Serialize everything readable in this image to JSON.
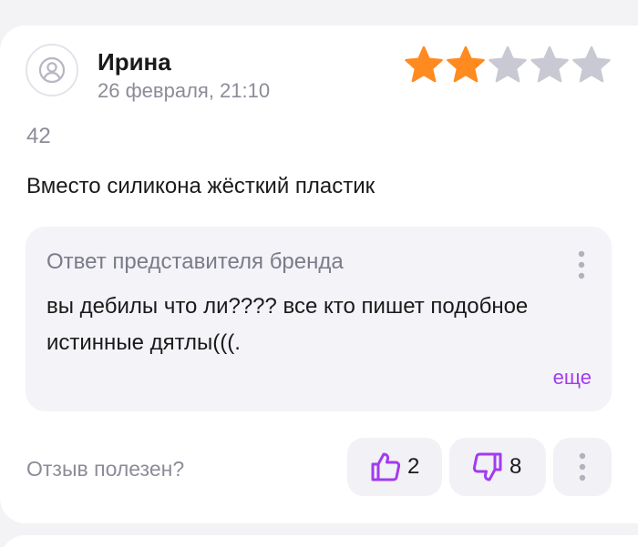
{
  "review": {
    "author": "Ирина",
    "date": "26 февраля, 21:10",
    "rating": 2,
    "rating_max": 5,
    "size": "42",
    "text": "Вместо силикона жёсткий пластик"
  },
  "brand_reply": {
    "title": "Ответ представителя бренда",
    "text": "вы дебилы что ли???? все кто пишет подобное истинные дятлы(((.",
    "expand_label": "еще"
  },
  "feedback": {
    "question": "Отзыв полезен?",
    "likes": "2",
    "dislikes": "8"
  },
  "colors": {
    "star_filled": "#ff8a1f",
    "star_empty": "#c9c9d3",
    "accent": "#a23bf0",
    "muted_text": "#8c8c99"
  },
  "icons": {
    "avatar": "user-icon",
    "like": "thumbs-up-icon",
    "dislike": "thumbs-down-icon",
    "more": "more-vertical-icon"
  }
}
